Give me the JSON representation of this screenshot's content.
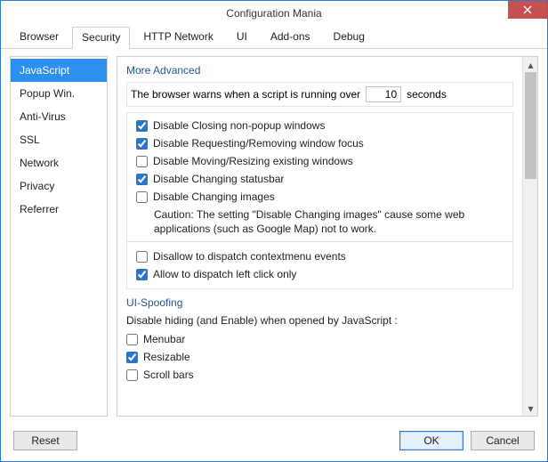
{
  "window": {
    "title": "Configuration Mania"
  },
  "tabs": [
    {
      "label": "Browser"
    },
    {
      "label": "Security",
      "active": true
    },
    {
      "label": "HTTP Network"
    },
    {
      "label": "UI"
    },
    {
      "label": "Add-ons"
    },
    {
      "label": "Debug"
    }
  ],
  "sidebar": {
    "items": [
      {
        "label": "JavaScript",
        "active": true
      },
      {
        "label": "Popup Win."
      },
      {
        "label": "Anti-Virus"
      },
      {
        "label": "SSL"
      },
      {
        "label": "Network"
      },
      {
        "label": "Privacy"
      },
      {
        "label": "Referrer"
      }
    ]
  },
  "groups": {
    "more_advanced": {
      "title": "More Advanced",
      "warn_prefix": "The browser warns when a script is running over",
      "warn_value": "10",
      "warn_suffix": "seconds",
      "options": [
        {
          "label": "Disable Closing non-popup windows",
          "checked": true
        },
        {
          "label": "Disable Requesting/Removing window focus",
          "checked": true
        },
        {
          "label": "Disable Moving/Resizing existing windows",
          "checked": false
        },
        {
          "label": "Disable Changing statusbar",
          "checked": true
        },
        {
          "label": "Disable Changing images",
          "checked": false
        },
        {
          "label": "Disallow to dispatch contextmenu events",
          "checked": false
        },
        {
          "label": "Allow to dispatch left click only",
          "checked": true
        }
      ],
      "caution": "Caution: The setting \"Disable Changing images\" cause some web applications (such as Google Map) not to work."
    },
    "ui_spoofing": {
      "title": "UI-Spoofing",
      "subtitle": "Disable hiding (and Enable) when opened by JavaScript :",
      "options": [
        {
          "label": "Menubar",
          "checked": false
        },
        {
          "label": "Resizable",
          "checked": true
        },
        {
          "label": "Scroll bars",
          "checked": false
        }
      ]
    }
  },
  "buttons": {
    "reset": "Reset",
    "ok": "OK",
    "cancel": "Cancel"
  }
}
